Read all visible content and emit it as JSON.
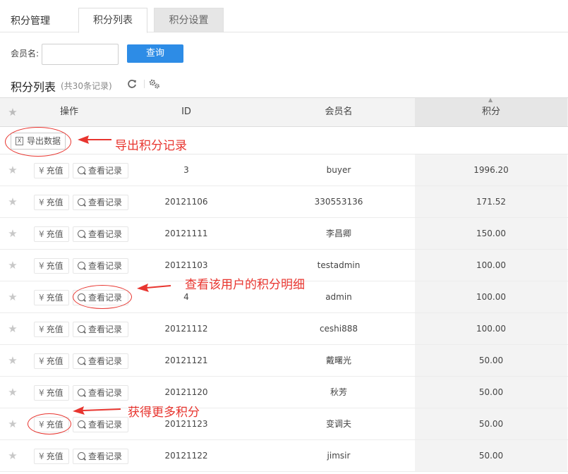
{
  "tabs": {
    "title": "积分管理",
    "items": [
      {
        "label": "积分列表",
        "active": true
      },
      {
        "label": "积分设置",
        "active": false
      }
    ]
  },
  "search": {
    "label": "会员名:",
    "value": "",
    "placeholder": "",
    "button_label": "查询"
  },
  "list": {
    "title": "积分列表",
    "count_text": "(共30条记录)",
    "toolbar_icons": [
      "refresh-icon",
      "settings-icon"
    ]
  },
  "table": {
    "columns": [
      "操作",
      "ID",
      "会员名",
      "积分"
    ],
    "sorted_column": "积分",
    "export_label": "导出数据",
    "recharge_label": "充值",
    "view_label": "查看记录",
    "rows": [
      {
        "id": "3",
        "name": "buyer",
        "points": "1996.20"
      },
      {
        "id": "20121106",
        "name": "330553136",
        "points": "171.52"
      },
      {
        "id": "20121111",
        "name": "李昌卿",
        "points": "150.00"
      },
      {
        "id": "20121103",
        "name": "testadmin",
        "points": "100.00"
      },
      {
        "id": "4",
        "name": "admin",
        "points": "100.00"
      },
      {
        "id": "20121112",
        "name": "ceshi888",
        "points": "100.00"
      },
      {
        "id": "20121121",
        "name": "戴曙光",
        "points": "50.00"
      },
      {
        "id": "20121120",
        "name": "秋芳",
        "points": "50.00"
      },
      {
        "id": "20121123",
        "name": "变调夫",
        "points": "50.00"
      },
      {
        "id": "20121122",
        "name": "jimsir",
        "points": "50.00"
      }
    ]
  },
  "annotations": {
    "export": "导出积分记录",
    "view": "查看该用户的积分明细",
    "recharge": "获得更多积分",
    "color": "#e8352f"
  },
  "colors": {
    "primary_button": "#2d8ce6",
    "sorted_column_bg": "#e6e6e6"
  }
}
